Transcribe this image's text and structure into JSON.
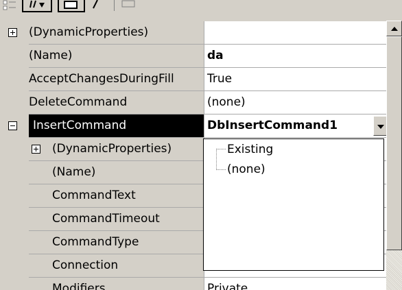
{
  "toolbar": {
    "buttons": [
      {
        "icon": "categorized-icon"
      },
      {
        "icon": "alphabetical-icon"
      },
      {
        "icon": "properties-icon"
      },
      {
        "icon": "events-icon"
      },
      {
        "icon": "property-pages-icon"
      }
    ]
  },
  "grid": {
    "rows": [
      {
        "label": "(DynamicProperties)",
        "value": "",
        "expander": "plus",
        "indent": false,
        "bold_value": false
      },
      {
        "label": "(Name)",
        "value": "da",
        "expander": "",
        "indent": false,
        "bold_value": true
      },
      {
        "label": "AcceptChangesDuringFill",
        "value": "True",
        "expander": "",
        "indent": false,
        "bold_value": false
      },
      {
        "label": "DeleteCommand",
        "value": "(none)",
        "expander": "",
        "indent": false,
        "bold_value": false
      },
      {
        "label": "InsertCommand",
        "value": "DbInsertCommand1",
        "expander": "minus",
        "indent": false,
        "bold_value": true,
        "selected": true
      },
      {
        "label": "(DynamicProperties)",
        "value": "",
        "expander": "plus",
        "indent": true
      },
      {
        "label": "(Name)",
        "value": "",
        "expander": "",
        "indent": true
      },
      {
        "label": "CommandText",
        "value": "",
        "expander": "",
        "indent": true
      },
      {
        "label": "CommandTimeout",
        "value": "",
        "expander": "",
        "indent": true
      },
      {
        "label": "CommandType",
        "value": "",
        "expander": "",
        "indent": true
      },
      {
        "label": "Connection",
        "value": "",
        "expander": "",
        "indent": true
      },
      {
        "label": "Modifiers",
        "value": "Private",
        "expander": "",
        "indent": true
      }
    ]
  },
  "dropdown": {
    "items": [
      "Existing",
      "(none)"
    ]
  },
  "colors": {
    "background": "#d4d0c8",
    "selection": "#000000",
    "selection_text": "#ffffff",
    "value_background": "#ffffff",
    "grid_line": "#a9a9a9"
  }
}
